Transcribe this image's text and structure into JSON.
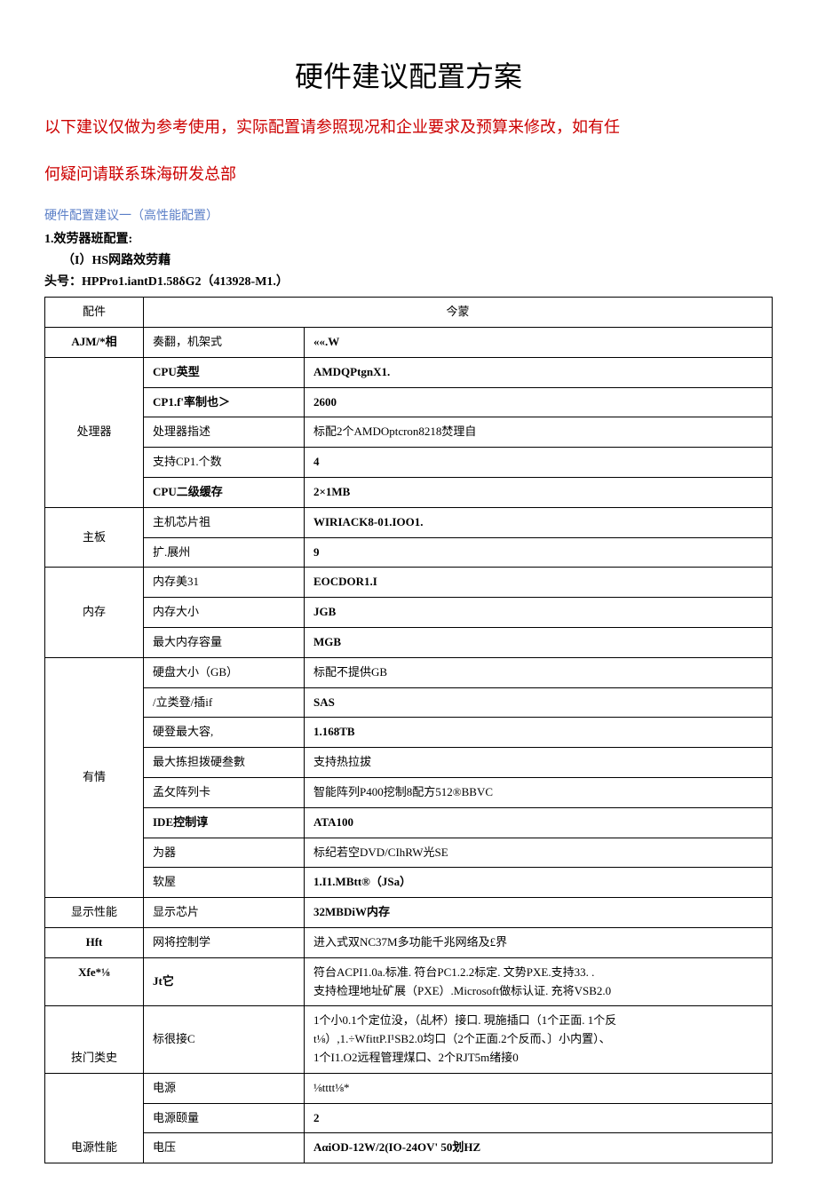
{
  "title": "硬件建议配置方案",
  "notice": "以下建议仅做为参考使用，实际配置请参照现况和企业要求及预算来修改，如有任",
  "notice2": "何疑问请联系珠海研发总部",
  "subheading": "硬件配置建议一（高性能配置）",
  "line1": "1.效劳器班配置:",
  "line2": "（I）HS网路效劳藉",
  "line3": "头号：HPPro1.iantD1.58δG2（413928-M1.）",
  "table": {
    "header": {
      "cat": "配件",
      "val": "今蒙"
    },
    "rows": [
      {
        "cat": "AJM/*相",
        "key": "奏翻，机架式",
        "val": "««.W"
      },
      {
        "cat": "处理器",
        "items": [
          {
            "key": "CPU英型",
            "val": "AMDQPtgnX1."
          },
          {
            "key": "CP1.f'率制也＞",
            "val": "2600"
          },
          {
            "key": "处理器指述",
            "val": "标配2个AMDOptcron8218焚理自"
          },
          {
            "key": "支持CP1.个数",
            "val": "4"
          },
          {
            "key": "CPU二级缓存",
            "val": "2×1MB"
          }
        ]
      },
      {
        "cat": "主板",
        "items": [
          {
            "key": "主机芯片祖",
            "val": "WIRIACK8-01.IOO1."
          },
          {
            "key": "扩.展州",
            "val": "9"
          }
        ]
      },
      {
        "cat": "内存",
        "items": [
          {
            "key": "内存美31",
            "val": "EOCDOR1.I"
          },
          {
            "key": "内存大小",
            "val": "JGB"
          },
          {
            "key": "最大内存容量",
            "val": "MGB"
          }
        ]
      },
      {
        "cat": "有情",
        "items": [
          {
            "key": "硬盘大小（GB）",
            "val": "标配不提供GB"
          },
          {
            "key": "/立类登/插if",
            "val": "SAS"
          },
          {
            "key": "硬登最大容,",
            "val": "1.168TB"
          },
          {
            "key": "最大拣担拨硬叁數",
            "val": "支持热拉拔"
          },
          {
            "key": "孟攵阵列卡",
            "val": "智能阵列P400挖制8配方512®BBVC"
          },
          {
            "key": "IDE控制谆",
            "val": "ATA100"
          },
          {
            "key": "为器",
            "val": "标纪若空DVD/CIhRW光SE"
          },
          {
            "key": "软屋",
            "val": "1.I1.MBtt®（JSa）"
          }
        ]
      },
      {
        "cat": "显示性能",
        "key": "显示芯片",
        "val": "32MBDiW内存"
      },
      {
        "cat": "Hft",
        "key": "网将控制学",
        "val": "进入式双NC37M多功能千兆网络及£界"
      },
      {
        "cat": "Xfe*⅛",
        "key": "Jt它",
        "val": "符台ACPI1.0a.标准. 符台PC1.2.2标定. 文势PXE.支持33. .\n支持检理地址矿展（PXE）.Microsoft做标认证. 充将VSB2.0"
      },
      {
        "cat": "技门类史",
        "key": "标很接C",
        "val": "1个小0.1个定位没，（乩杯）接口. 現施插口（1个正面. 1个反\nt⅛）,1.÷WfittP.I¹SB2.0均口（2个正面.2个反而、〕小内置）、\n1个I1.O2远程管理煤口、2个RJT5m绪接0"
      },
      {
        "cat": "电源性能",
        "items": [
          {
            "key": "电源",
            "val": "⅛tttt⅛*"
          },
          {
            "key": "电源颐量",
            "val": "2"
          },
          {
            "key": "电压",
            "val": "AαiOD-12W/2(IO-24OV'  50划HZ"
          }
        ]
      }
    ]
  }
}
